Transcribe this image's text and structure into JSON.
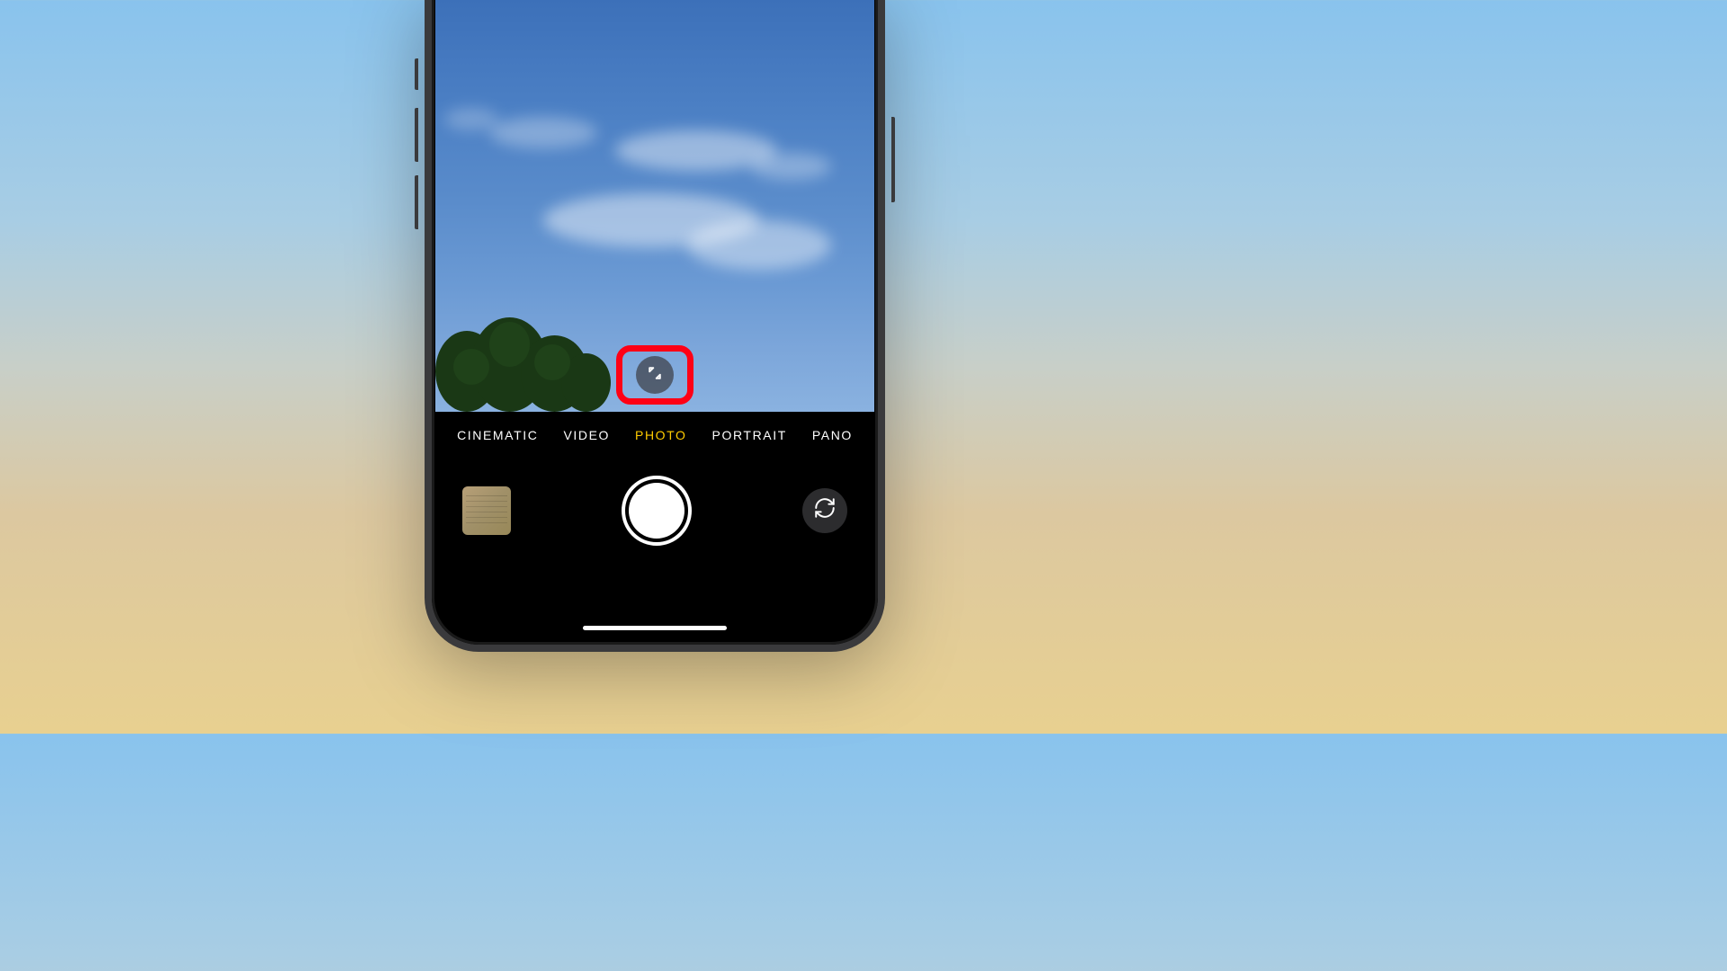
{
  "modes": {
    "cinematic": "CINEMATIC",
    "video": "VIDEO",
    "photo": "PHOTO",
    "portrait": "PORTRAIT",
    "pano": "PANO"
  },
  "active_mode": "photo",
  "icons": {
    "aspect_toggle": "expand-arrows-icon",
    "flip_camera": "camera-flip-icon"
  },
  "highlight_color": "#ff0015",
  "accent_color": "#ffcc00"
}
